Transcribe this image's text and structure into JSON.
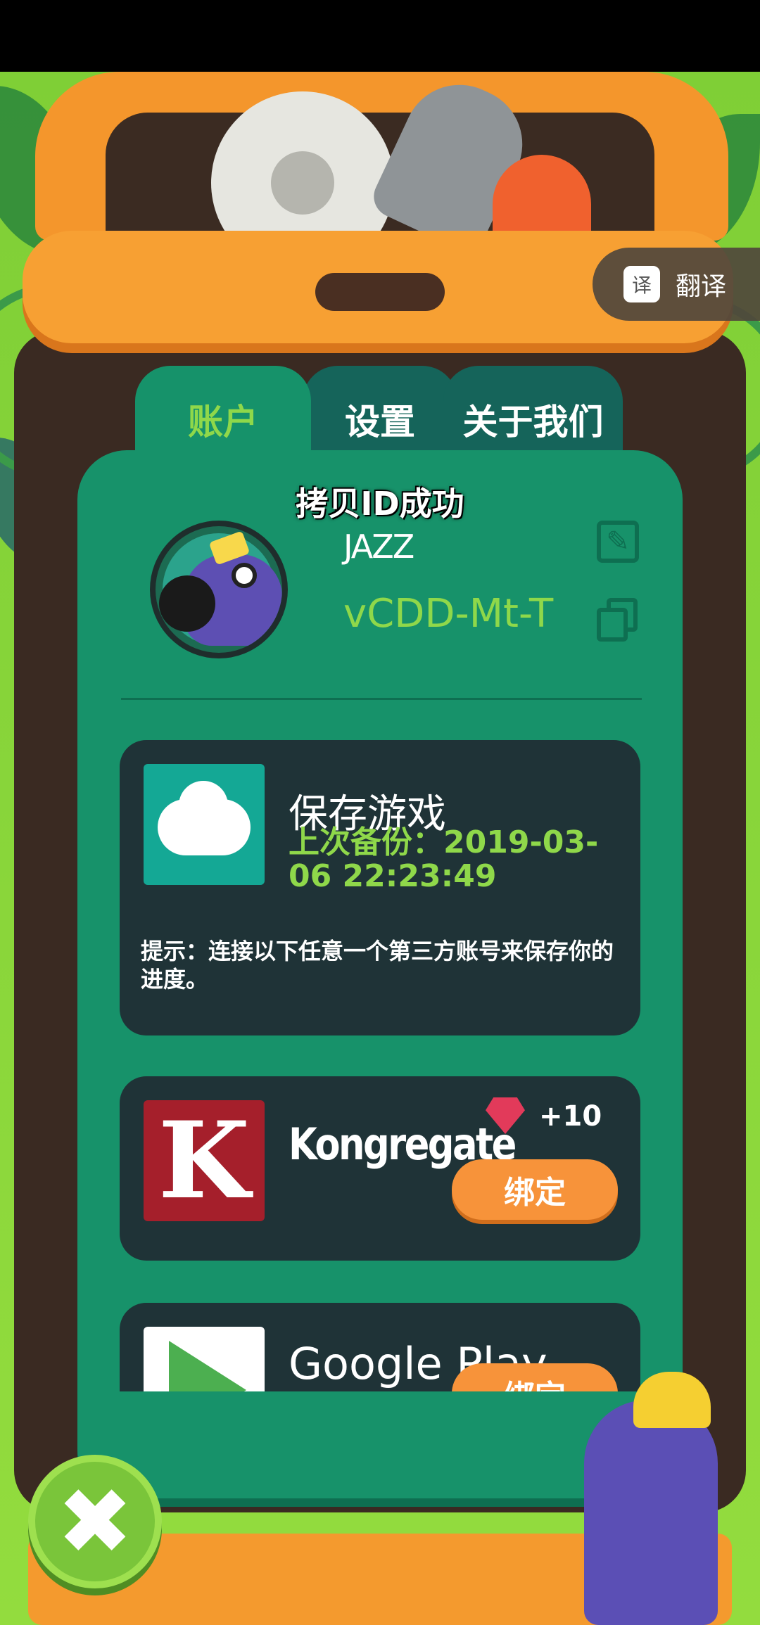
{
  "translate": {
    "icon_glyph": "译",
    "label": "翻译"
  },
  "tabs": [
    {
      "label": "账户",
      "active": true
    },
    {
      "label": "设置",
      "active": false
    },
    {
      "label": "关于我们",
      "active": false
    }
  ],
  "toast": "拷贝ID成功",
  "profile": {
    "username": "JAZZ",
    "user_id": "vCDD-Mt-T"
  },
  "save_card": {
    "title": "保存游戏",
    "last_backup": "上次备份：2019-03-06 22:23:49",
    "hint": "提示：连接以下任意一个第三方账号来保存你的进度。"
  },
  "kongregate": {
    "title": "Kongregate",
    "icon_letter": "K",
    "reward": "+10",
    "bind_label": "绑定"
  },
  "google_play": {
    "title": "Google Play",
    "bind_label": "绑定"
  },
  "close": {
    "glyph": "✖"
  },
  "colors": {
    "panel": "#17926a",
    "card": "#1f3337",
    "accent_green": "#8fd84a",
    "bind_orange": "#f7933a"
  }
}
